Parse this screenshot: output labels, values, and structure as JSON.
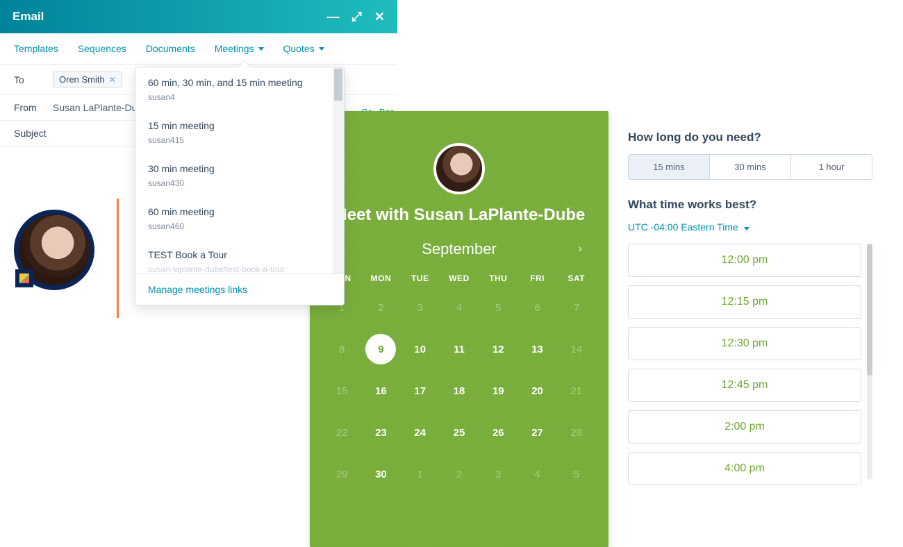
{
  "window": {
    "title": "Email"
  },
  "toolbar": {
    "templates": "Templates",
    "sequences": "Sequences",
    "documents": "Documents",
    "meetings": "Meetings",
    "quotes": "Quotes"
  },
  "fields": {
    "to_label": "To",
    "from_label": "From",
    "subject_label": "Subject",
    "to_chip": "Oren Smith",
    "from_value": "Susan LaPlante-Dub",
    "cc": "Cc",
    "bcc": "Bcc"
  },
  "meetings_menu": {
    "items": [
      {
        "title": "60 min, 30 min, and 15 min meeting",
        "sub": "susan4"
      },
      {
        "title": "15 min meeting",
        "sub": "susan415"
      },
      {
        "title": "30 min meeting",
        "sub": "susan430"
      },
      {
        "title": "60 min meeting",
        "sub": "susan460"
      },
      {
        "title": "TEST Book a Tour",
        "sub": "susan-laplante-dube/test-book-a-tour"
      }
    ],
    "manage": "Manage meetings links"
  },
  "calendar": {
    "heading": "Meet with Susan LaPlante-Dube",
    "month": "September",
    "dow": [
      "SUN",
      "MON",
      "TUE",
      "WED",
      "THU",
      "FRI",
      "SAT"
    ],
    "weeks": [
      [
        {
          "n": "1",
          "m": true
        },
        {
          "n": "2",
          "m": true
        },
        {
          "n": "3",
          "m": true
        },
        {
          "n": "4",
          "m": true
        },
        {
          "n": "5",
          "m": true
        },
        {
          "n": "6",
          "m": true
        },
        {
          "n": "7",
          "m": true
        }
      ],
      [
        {
          "n": "8",
          "m": true
        },
        {
          "n": "9",
          "sel": true
        },
        {
          "n": "10"
        },
        {
          "n": "11"
        },
        {
          "n": "12"
        },
        {
          "n": "13"
        },
        {
          "n": "14",
          "m": true
        }
      ],
      [
        {
          "n": "15",
          "m": true
        },
        {
          "n": "16"
        },
        {
          "n": "17"
        },
        {
          "n": "18"
        },
        {
          "n": "19"
        },
        {
          "n": "20"
        },
        {
          "n": "21",
          "m": true
        }
      ],
      [
        {
          "n": "22",
          "m": true
        },
        {
          "n": "23"
        },
        {
          "n": "24"
        },
        {
          "n": "25"
        },
        {
          "n": "26"
        },
        {
          "n": "27"
        },
        {
          "n": "28",
          "m": true
        }
      ],
      [
        {
          "n": "29",
          "m": true
        },
        {
          "n": "30"
        },
        {
          "n": "1",
          "m": true
        },
        {
          "n": "2",
          "m": true
        },
        {
          "n": "3",
          "m": true
        },
        {
          "n": "4",
          "m": true
        },
        {
          "n": "5",
          "m": true
        }
      ]
    ]
  },
  "booking": {
    "duration_heading": "How long do you need?",
    "durations": [
      "15 mins",
      "30 mins",
      "1 hour"
    ],
    "selected_duration_index": 0,
    "time_heading": "What time works best?",
    "timezone": "UTC -04:00 Eastern Time",
    "slots": [
      "12:00 pm",
      "12:15 pm",
      "12:30 pm",
      "12:45 pm",
      "2:00 pm",
      "4:00 pm"
    ]
  }
}
